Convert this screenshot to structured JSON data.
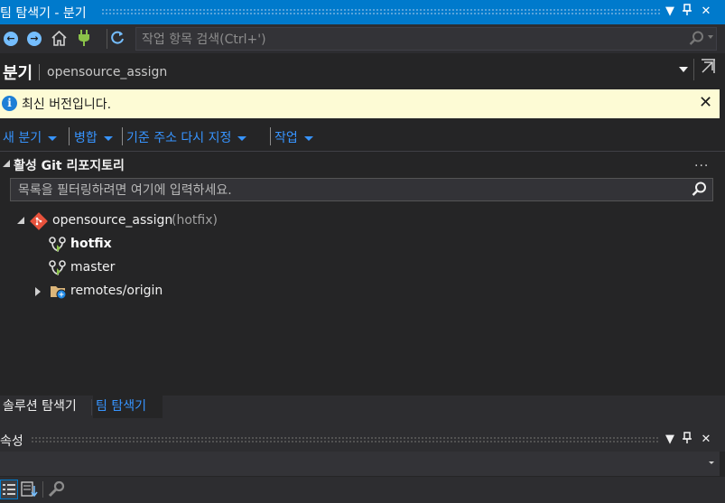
{
  "window": {
    "title": "팀 탐색기 - 분기"
  },
  "toolbar": {
    "search_placeholder": "작업 항목 검색(Ctrl+')"
  },
  "header": {
    "title": "분기",
    "subtitle": "opensource_assign"
  },
  "infobar": {
    "message": "최신 버전입니다."
  },
  "actions": [
    {
      "label": "새 분기"
    },
    {
      "label": "병합"
    },
    {
      "label": "기준 주소 다시 지정"
    },
    {
      "label": "작업"
    }
  ],
  "section": {
    "title": "활성 Git 리포지토리",
    "more": "...",
    "filter_placeholder": "목록을 필터링하려면 여기에 입력하세요."
  },
  "tree": {
    "repo": {
      "name": "opensource_assign",
      "branch": "(hotfix)"
    },
    "branches": [
      {
        "name": "hotfix",
        "current": true
      },
      {
        "name": "master",
        "current": false
      }
    ],
    "remote": {
      "name": "remotes/origin"
    }
  },
  "tabs": [
    {
      "label": "솔루션 탐색기",
      "active": false
    },
    {
      "label": "팀 탐색기",
      "active": true
    }
  ],
  "properties": {
    "title": "속성"
  },
  "colors": {
    "accent": "#007acc",
    "link": "#3794ff",
    "infobar_bg": "#fdfbd5",
    "panel_bg": "#252526"
  }
}
